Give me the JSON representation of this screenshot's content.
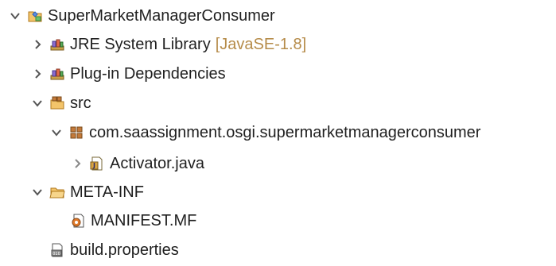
{
  "tree": {
    "project": {
      "label": "SuperMarketManagerConsumer",
      "expanded": true,
      "icon": "plugin-project-icon"
    },
    "jre": {
      "label": "JRE System Library",
      "decoration": "[JavaSE-1.8]",
      "expanded": false,
      "icon": "library-icon"
    },
    "plugin_deps": {
      "label": "Plug-in Dependencies",
      "expanded": false,
      "icon": "library-icon"
    },
    "src": {
      "label": "src",
      "expanded": true,
      "icon": "source-folder-icon"
    },
    "package": {
      "label": "com.saassignment.osgi.supermarketmanagerconsumer",
      "expanded": true,
      "icon": "package-icon"
    },
    "activator": {
      "label": "Activator.java",
      "expanded": false,
      "icon": "java-file-icon"
    },
    "meta_inf": {
      "label": "META-INF",
      "expanded": true,
      "icon": "folder-icon"
    },
    "manifest": {
      "label": "MANIFEST.MF",
      "icon": "manifest-file-icon"
    },
    "build_props": {
      "label": "build.properties",
      "icon": "properties-file-icon"
    }
  },
  "colors": {
    "text": "#1f1f1f",
    "decoration": "#b68c4a",
    "chevron": "#555555"
  }
}
